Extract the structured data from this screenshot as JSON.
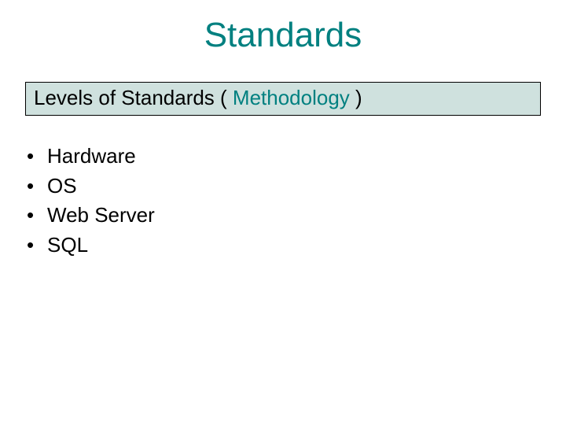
{
  "title": "Standards",
  "subtitle": {
    "prefix": "Levels of Standards ( ",
    "keyword": "Methodology",
    "suffix": " )"
  },
  "bullets": [
    "Hardware",
    "OS",
    "Web Server",
    "SQL"
  ],
  "bullet_char": "•"
}
